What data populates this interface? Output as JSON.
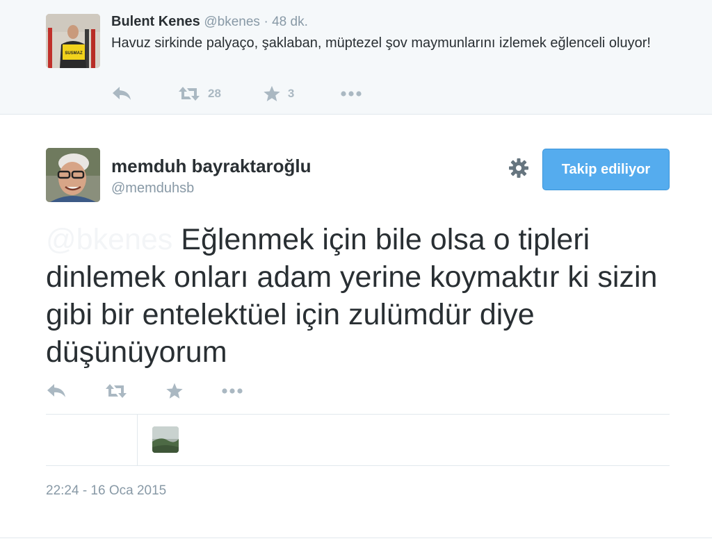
{
  "parent_tweet": {
    "name": "Bulent Kenes",
    "handle": "@bkenes",
    "time": "· 48 dk.",
    "text": "Havuz sirkinde palyaço, şaklaban, müptezel şov maymunlarını izlemek eğlenceli oluyor!",
    "avatar_sign_text": "SUSMAZ",
    "retweet_count": "28",
    "favorite_count": "3",
    "icons": [
      "reply-icon",
      "retweet-icon",
      "star-icon",
      "more-icon"
    ]
  },
  "main_tweet": {
    "name": "memduh bayraktaroğlu",
    "handle": "@memduhsb",
    "follow_button_label": "Takip ediliyor",
    "mention": "@bkenes",
    "text": "Eğlenmek için bile olsa o tipleri dinlemek onları adam yerine koymaktır ki sizin gibi bir entelektüel için zulümdür diye düşünüyorum",
    "timestamp": "22:24 - 16 Oca 2015",
    "icons": [
      "settings-gear-icon",
      "reply-icon",
      "retweet-icon",
      "star-icon",
      "more-icon"
    ]
  },
  "colors": {
    "accent": "#55acee",
    "text": "#292f33",
    "muted": "#8899a6",
    "icon": "#aab8c2",
    "parent_background": "#f5f8fa"
  }
}
